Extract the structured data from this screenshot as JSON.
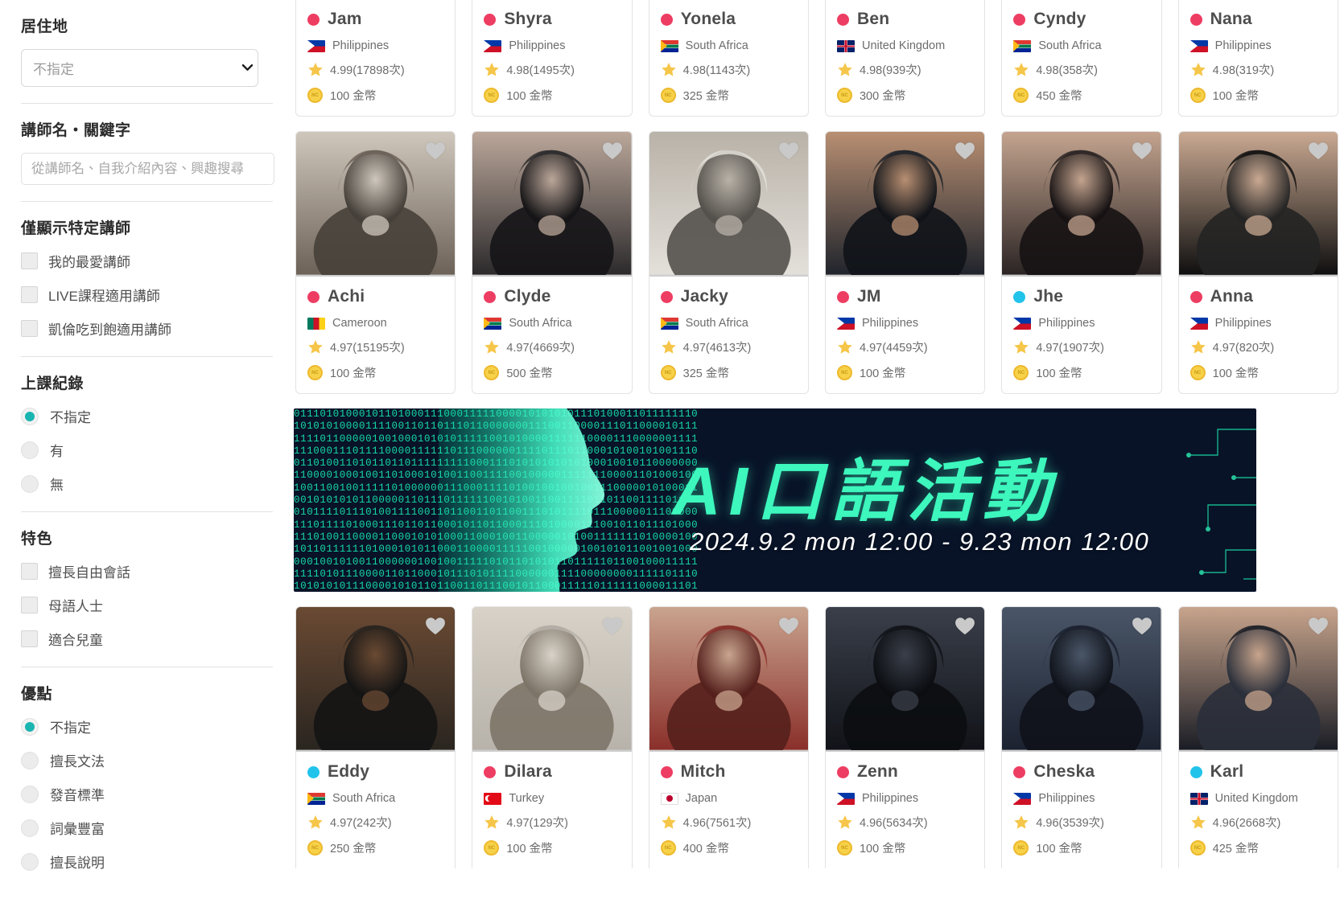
{
  "sidebar": {
    "residence": {
      "title": "居住地",
      "selected": "不指定",
      "chevron_icon": "chevron-down-icon"
    },
    "keyword": {
      "title": "講師名・關鍵字",
      "placeholder": "從講師名、自我介紹內容、興趣搜尋",
      "value": ""
    },
    "only_show": {
      "title": "僅顯示特定講師",
      "options": [
        {
          "label": "我的最愛講師",
          "checked": false
        },
        {
          "label": "LIVE課程適用講師",
          "checked": false
        },
        {
          "label": "凱倫吃到飽適用講師",
          "checked": false
        }
      ]
    },
    "lesson_record": {
      "title": "上課紀錄",
      "options": [
        {
          "label": "不指定",
          "checked": true
        },
        {
          "label": "有",
          "checked": false
        },
        {
          "label": "無",
          "checked": false
        }
      ]
    },
    "features": {
      "title": "特色",
      "options": [
        {
          "label": "擅長自由會話",
          "checked": false
        },
        {
          "label": "母語人士",
          "checked": false
        },
        {
          "label": "適合兒童",
          "checked": false
        }
      ]
    },
    "strengths": {
      "title": "優點",
      "options": [
        {
          "label": "不指定",
          "checked": true
        },
        {
          "label": "擅長文法",
          "checked": false
        },
        {
          "label": "發音標準",
          "checked": false
        },
        {
          "label": "詞彙豐富",
          "checked": false
        },
        {
          "label": "擅長說明",
          "checked": false
        }
      ]
    },
    "accent_color": "#1ab5b0"
  },
  "icons": {
    "heart": "heart-icon",
    "star": "star-icon",
    "coin": "coin-icon",
    "status": "status-dot-icon"
  },
  "colors": {
    "status_offline": "#ee3d62",
    "status_online": "#22c3ea",
    "star": "#f6c64a",
    "coin": "#f7d147",
    "banner_bg": "#081328",
    "banner_text": "#3df7bd"
  },
  "units": {
    "rating_suffix": "次",
    "coin_suffix": "金幣"
  },
  "rows": [
    {
      "clipped": "top",
      "tutors": [
        {
          "name": "Jam",
          "status": "offline",
          "country": "Philippines",
          "flag": "ph",
          "rating": "4.99",
          "reviews": "17898",
          "coins": "100"
        },
        {
          "name": "Shyra",
          "status": "offline",
          "country": "Philippines",
          "flag": "ph",
          "rating": "4.98",
          "reviews": "1495",
          "coins": "100"
        },
        {
          "name": "Yonela",
          "status": "offline",
          "country": "South Africa",
          "flag": "za",
          "rating": "4.98",
          "reviews": "1143",
          "coins": "325"
        },
        {
          "name": "Ben",
          "status": "offline",
          "country": "United Kingdom",
          "flag": "uk",
          "rating": "4.98",
          "reviews": "939",
          "coins": "300"
        },
        {
          "name": "Cyndy",
          "status": "offline",
          "country": "South Africa",
          "flag": "za",
          "rating": "4.98",
          "reviews": "358",
          "coins": "450"
        },
        {
          "name": "Nana",
          "status": "offline",
          "country": "Philippines",
          "flag": "ph",
          "rating": "4.98",
          "reviews": "319",
          "coins": "100"
        }
      ]
    },
    {
      "clipped": "none",
      "tutors": [
        {
          "name": "Achi",
          "status": "offline",
          "country": "Cameroon",
          "flag": "cm",
          "rating": "4.97",
          "reviews": "15195",
          "coins": "100"
        },
        {
          "name": "Clyde",
          "status": "offline",
          "country": "South Africa",
          "flag": "za",
          "rating": "4.97",
          "reviews": "4669",
          "coins": "500"
        },
        {
          "name": "Jacky",
          "status": "offline",
          "country": "South Africa",
          "flag": "za",
          "rating": "4.97",
          "reviews": "4613",
          "coins": "325"
        },
        {
          "name": "JM",
          "status": "offline",
          "country": "Philippines",
          "flag": "ph",
          "rating": "4.97",
          "reviews": "4459",
          "coins": "100"
        },
        {
          "name": "Jhe",
          "status": "online",
          "country": "Philippines",
          "flag": "ph",
          "rating": "4.97",
          "reviews": "1907",
          "coins": "100"
        },
        {
          "name": "Anna",
          "status": "offline",
          "country": "Philippines",
          "flag": "ph",
          "rating": "4.97",
          "reviews": "820",
          "coins": "100"
        }
      ]
    },
    {
      "clipped": "bottom",
      "tutors": [
        {
          "name": "Eddy",
          "status": "online",
          "country": "South Africa",
          "flag": "za",
          "rating": "4.97",
          "reviews": "242",
          "coins": "250"
        },
        {
          "name": "Dilara",
          "status": "offline",
          "country": "Turkey",
          "flag": "tr",
          "rating": "4.97",
          "reviews": "129",
          "coins": "100"
        },
        {
          "name": "Mitch",
          "status": "offline",
          "country": "Japan",
          "flag": "jp",
          "rating": "4.96",
          "reviews": "7561",
          "coins": "400"
        },
        {
          "name": "Zenn",
          "status": "offline",
          "country": "Philippines",
          "flag": "ph",
          "rating": "4.96",
          "reviews": "5634",
          "coins": "100"
        },
        {
          "name": "Cheska",
          "status": "offline",
          "country": "Philippines",
          "flag": "ph",
          "rating": "4.96",
          "reviews": "3539",
          "coins": "100"
        },
        {
          "name": "Karl",
          "status": "online",
          "country": "United Kingdom",
          "flag": "uk",
          "rating": "4.96",
          "reviews": "2668",
          "coins": "425"
        }
      ]
    }
  ],
  "banner": {
    "title": "AI口語活動",
    "date": "2024.9.2 mon 12:00 - 9.23 mon 12:00",
    "alt": "AI speaking event banner"
  }
}
